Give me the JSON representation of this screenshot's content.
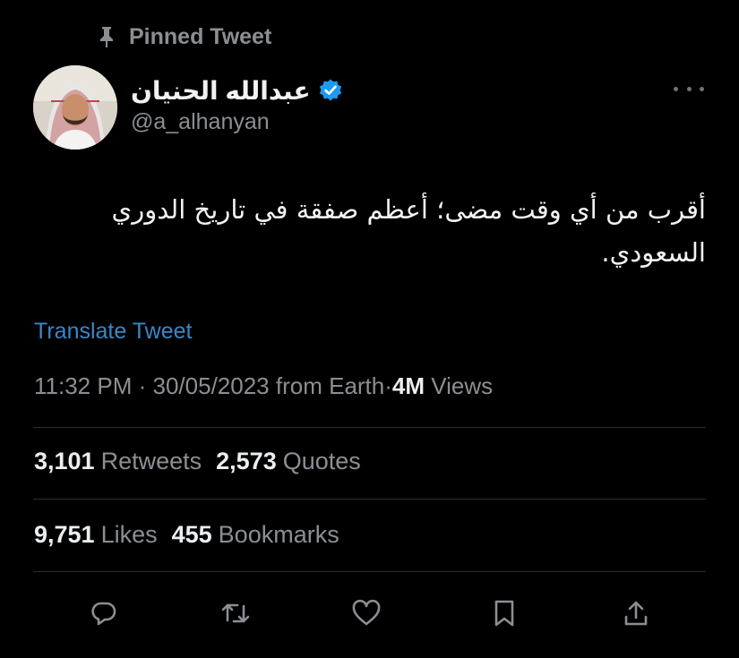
{
  "pinned": {
    "label": "Pinned Tweet",
    "icon": "pin-icon"
  },
  "author": {
    "display_name": "عبدالله الحنيان",
    "handle": "@a_alhanyan",
    "verified": true,
    "verified_color": "#1d9bf0"
  },
  "tweet": {
    "text": "أقرب من أي وقت مضى؛ أعظم صفقة في تاريخ الدوري السعودي.",
    "translate_label": "Translate Tweet",
    "time": "11:32 PM",
    "date": "30/05/2023",
    "source": "from Earth",
    "views_count": "4M",
    "views_label": "Views"
  },
  "stats": {
    "retweets_count": "3,101",
    "retweets_label": "Retweets",
    "quotes_count": "2,573",
    "quotes_label": "Quotes",
    "likes_count": "9,751",
    "likes_label": "Likes",
    "bookmarks_count": "455",
    "bookmarks_label": "Bookmarks"
  },
  "actions": [
    "reply-icon",
    "retweet-icon",
    "like-icon",
    "bookmark-icon",
    "share-icon"
  ],
  "colors": {
    "background": "#000000",
    "primary_text": "#e7e9ea",
    "secondary_text": "#8b8f94",
    "link": "#3a87c9",
    "divider": "#2a2d30"
  }
}
